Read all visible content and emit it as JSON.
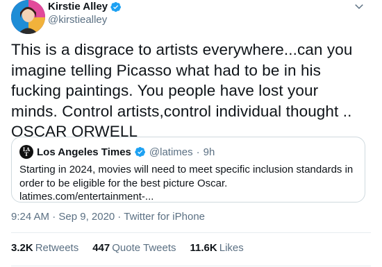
{
  "author": {
    "display_name": "Kirstie Alley",
    "handle": "@kirstiealley"
  },
  "tweet": {
    "text": "This is a disgrace to artists everywhere...can you imagine telling Picasso what had to be in his fucking paintings. You people have lost your minds. Control artists,control individual thought .. OSCAR ORWELL"
  },
  "quoted_tweet": {
    "logo_text": "LA Times",
    "display_name": "Los Angeles Times",
    "handle": "@latimes",
    "separator": "·",
    "time": "9h",
    "text": "Starting in 2024, movies will need to meet specific inclusion standards in order to be eligible for the best picture Oscar.  latimes.com/entertainment-..."
  },
  "meta": {
    "time": "9:24 AM · Sep 9, 2020",
    "separator": "·",
    "source": "Twitter for iPhone"
  },
  "stats": [
    {
      "count": "3.2K",
      "label": "Retweets"
    },
    {
      "count": "447",
      "label": "Quote Tweets"
    },
    {
      "count": "11.6K",
      "label": "Likes"
    }
  ],
  "colors": {
    "text": "#0f1419",
    "secondary": "#5b7083",
    "verified": "#1da1f2",
    "border": "#cfd9de"
  },
  "icons": {
    "verified": "verified-badge-icon",
    "more": "chevron-down-icon"
  }
}
